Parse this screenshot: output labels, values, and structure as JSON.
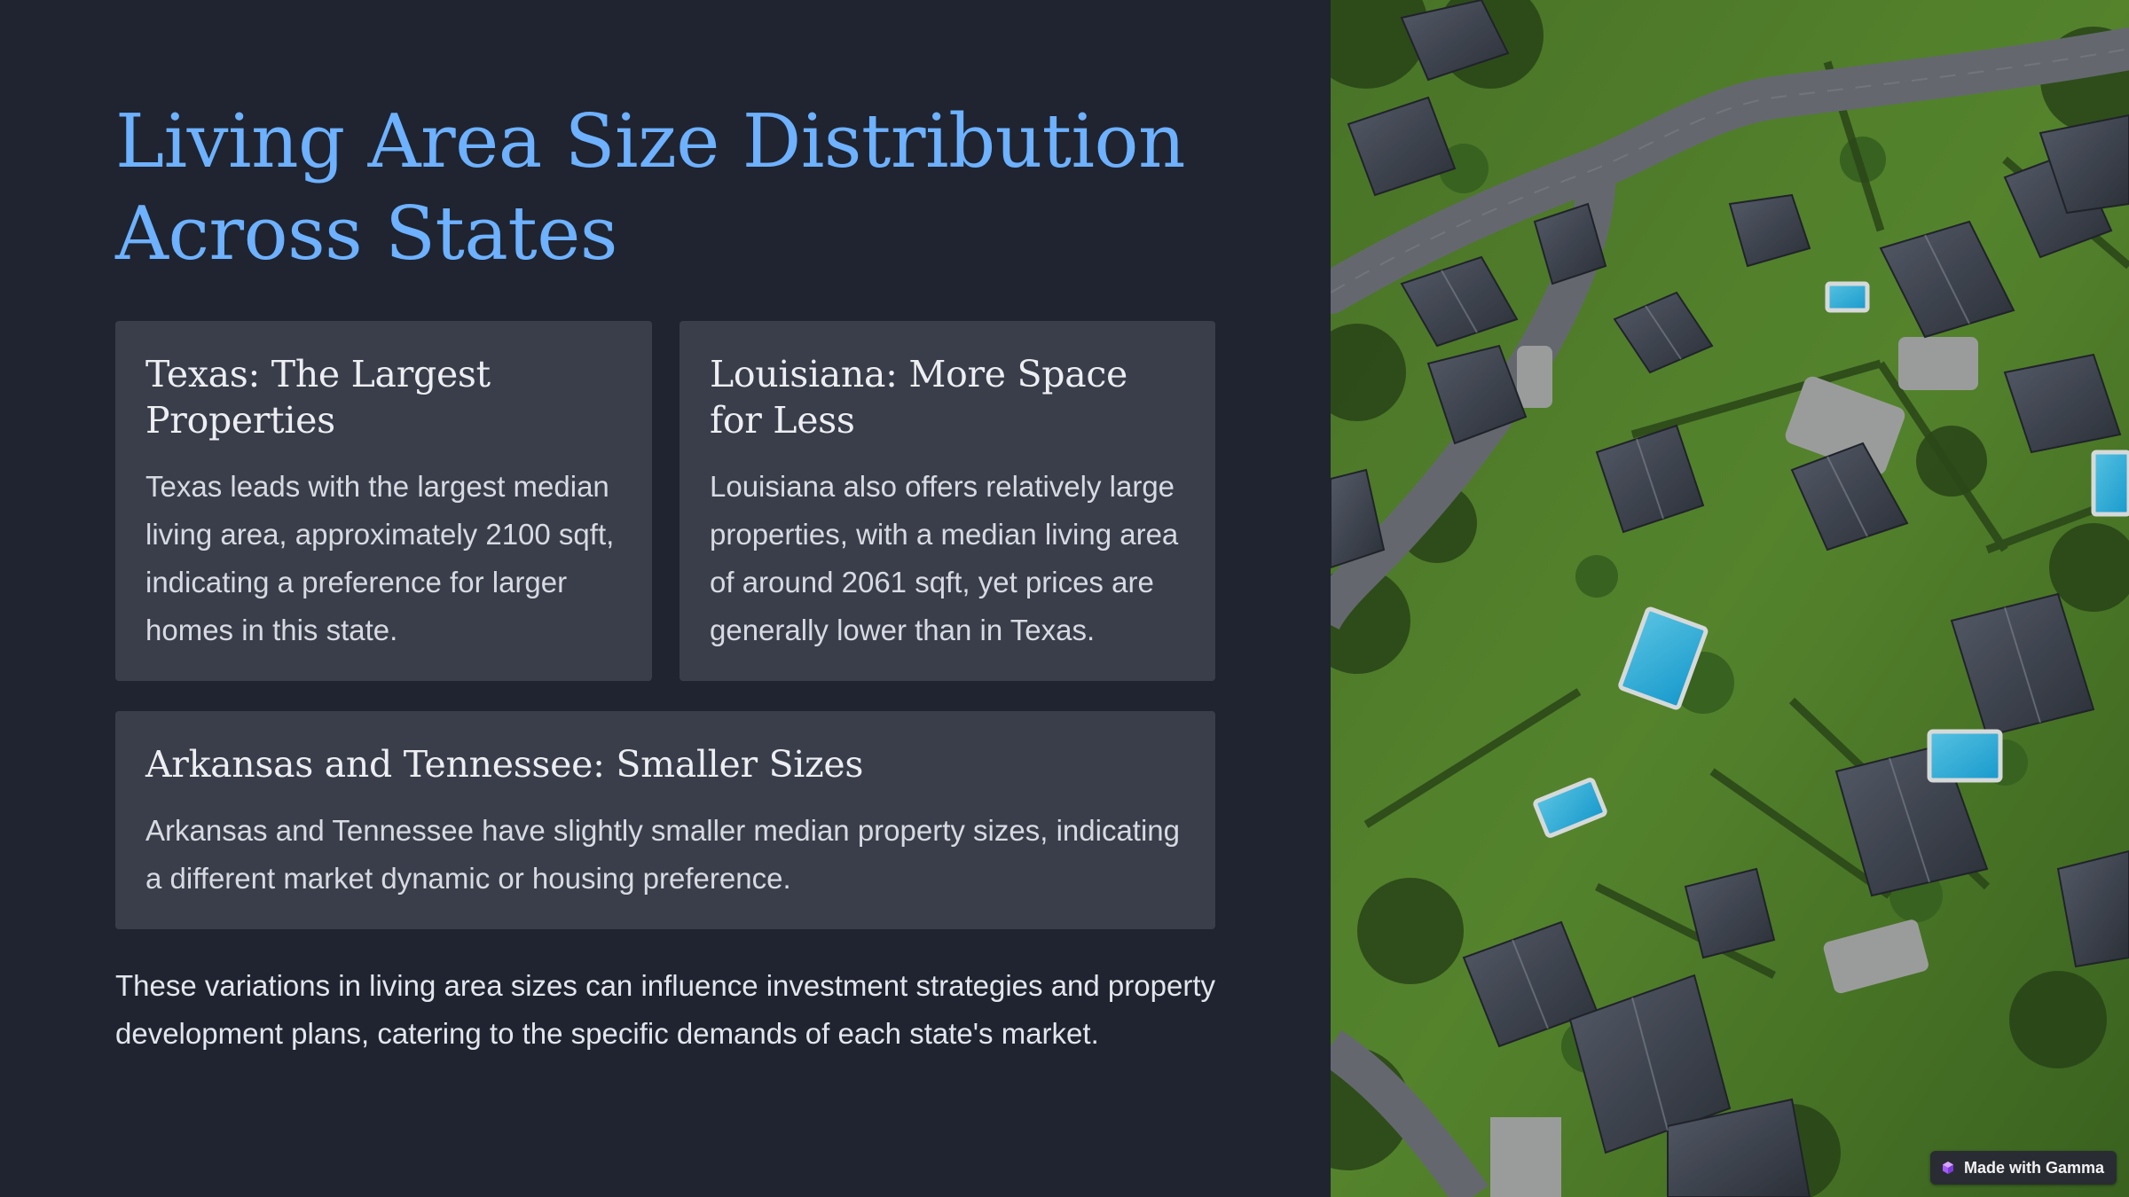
{
  "title": "Living Area Size Distribution Across States",
  "cards": {
    "texas": {
      "heading": "Texas: The Largest Properties",
      "body": "Texas leads with the largest median living area, approximately 2100 sqft, indicating a preference for larger homes in this state."
    },
    "louisiana": {
      "heading": "Louisiana: More Space for Less",
      "body": "Louisiana also offers relatively large properties, with a median living area of around 2061 sqft, yet prices are generally lower than in Texas."
    },
    "arkansas_tennessee": {
      "heading": "Arkansas and Tennessee: Smaller Sizes",
      "body": "Arkansas and Tennessee have slightly smaller median property sizes, indicating a different market dynamic or housing preference."
    }
  },
  "footer_text": "These variations in living area sizes can influence investment strategies and property development plans, catering to the specific demands of each state's market.",
  "badge": {
    "label": "Made with Gamma",
    "icon": "gamma-logo-icon"
  },
  "image": {
    "icon": "aerial-neighborhood-photo"
  },
  "colors": {
    "background": "#1f2430",
    "card": "#3a3e4a",
    "title": "#6db1ff",
    "text": "#d7dae1"
  }
}
